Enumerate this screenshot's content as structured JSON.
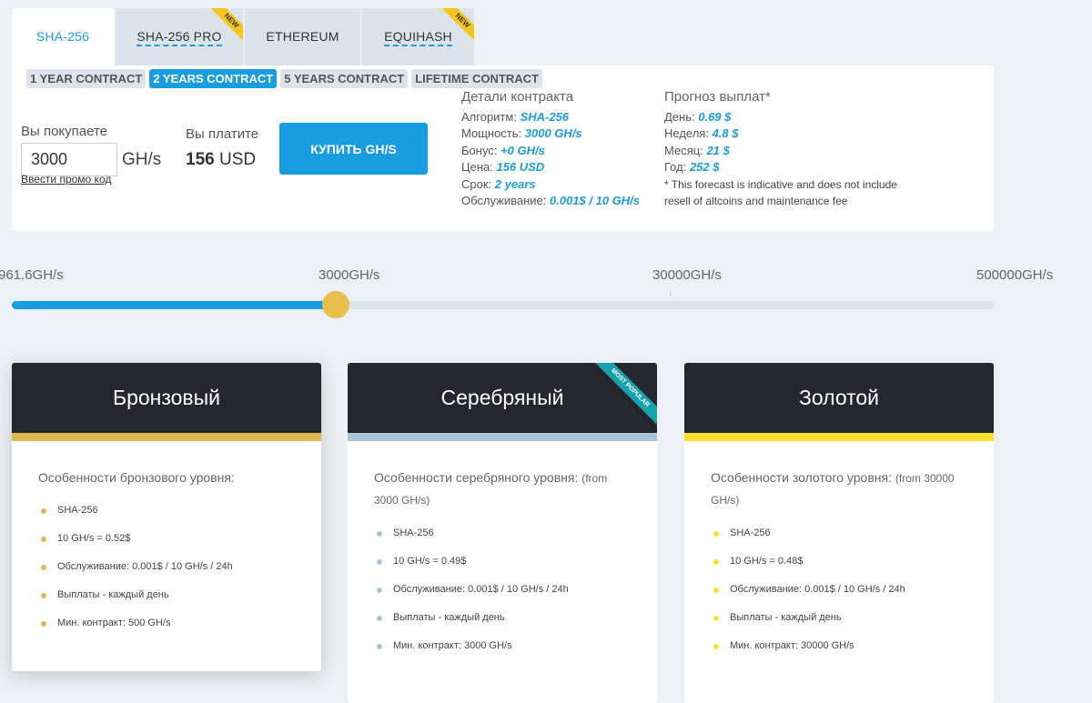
{
  "tabs": [
    {
      "label": "SHA-256",
      "active": true,
      "new": false
    },
    {
      "label": "SHA-256 PRO",
      "active": false,
      "new": true
    },
    {
      "label": "ETHEREUM",
      "active": false,
      "new": false
    },
    {
      "label": "EQUIHASH",
      "active": false,
      "new": true
    }
  ],
  "new_badge": "NEW",
  "contracts": [
    "1 YEAR CONTRACT",
    "2 YEARS CONTRACT",
    "5 YEARS CONTRACT",
    "LIFETIME CONTRACT"
  ],
  "active_contract": "2 YEARS CONTRACT",
  "purchase": {
    "buy_label": "Вы покупаете",
    "amount": "3000",
    "unit": "GH/s",
    "promo": "Ввести промо код",
    "pay_label": "Вы платите",
    "price_value": "156",
    "price_currency": "USD",
    "buy_button": "КУПИТЬ GH/S"
  },
  "details": {
    "title": "Детали контракта",
    "rows": [
      {
        "k": "Алгоритм:",
        "v": "SHA-256"
      },
      {
        "k": "Мощность:",
        "v": "3000 GH/s"
      },
      {
        "k": "Бонус:",
        "v": "+0 GH/s"
      },
      {
        "k": "Цена:",
        "v": "156 USD"
      },
      {
        "k": "Срок:",
        "v": "2 years"
      },
      {
        "k": "Обслуживание:",
        "v": "0.001$ / 10 GH/s"
      }
    ]
  },
  "forecast": {
    "title": "Прогноз выплат*",
    "rows": [
      {
        "k": "День:",
        "v": "0.69 $"
      },
      {
        "k": "Неделя:",
        "v": "4.8 $"
      },
      {
        "k": "Месяц:",
        "v": "21 $"
      },
      {
        "k": "Год:",
        "v": "252 $"
      }
    ],
    "note": "* This forecast is indicative and does not include resell of altcoins and maintenance fee"
  },
  "slider": {
    "labels": [
      "961.6GH/s",
      "3000GH/s",
      "30000GH/s",
      "500000GH/s"
    ],
    "level": 0.33
  },
  "colors": {
    "accent": "#1a9de0",
    "bronze": "#e0b64f",
    "silver": "#a8c6d8",
    "gold": "#f9e22d",
    "popular": "#17a2ad"
  },
  "plans": [
    {
      "key": "bronze",
      "name": "Бронзовый",
      "features_title": "Особенности бронзового уровня:",
      "features_note": "",
      "features": [
        "SHA-256",
        "10 GH/s = 0.52$",
        "Обслуживание: 0.001$ / 10 GH/s / 24h",
        "Выплаты - каждый день",
        "Мин. контракт: 500 GH/s"
      ]
    },
    {
      "key": "silver",
      "name": "Серебряный",
      "features_title": "Особенности серебряного уровня:",
      "features_note": "(from 3000 GH/s)",
      "badge": "MOST POPULAR",
      "features": [
        "SHA-256",
        "10 GH/s = 0.49$",
        "Обслуживание: 0.001$ / 10 GH/s / 24h",
        "Выплаты - каждый день",
        "Мин. контракт: 3000 GH/s"
      ]
    },
    {
      "key": "gold",
      "name": "Золотой",
      "features_title": "Особенности золотого уровня:",
      "features_note": "(from 30000 GH/s)",
      "features": [
        "SHA-256",
        "10 GH/s = 0.48$",
        "Обслуживание: 0.001$ / 10 GH/s / 24h",
        "Выплаты - каждый день",
        "Мин. контракт: 30000 GH/s"
      ]
    }
  ]
}
